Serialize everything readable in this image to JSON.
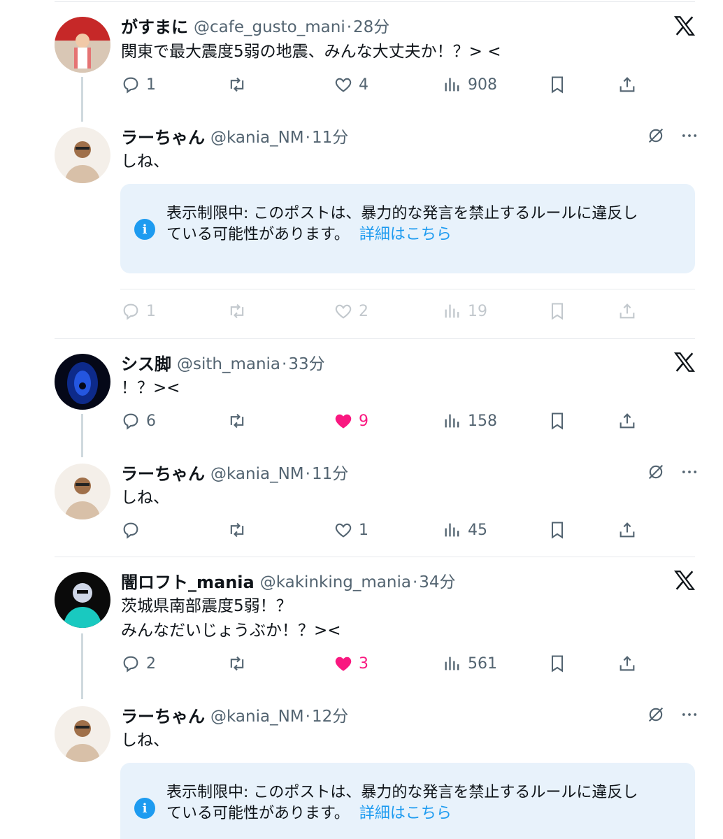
{
  "posts": [
    {
      "name": "がすまに",
      "handle": "@cafe_gusto_mani",
      "time": "28分",
      "body": [
        "関東で最大震度5弱の地震、みんな大丈夫か！？> <"
      ],
      "replies": "1",
      "reposts": "",
      "likes": "4",
      "views": "908",
      "liked": false
    },
    {
      "name": "ラーちゃん",
      "handle": "@kania_NM",
      "time": "11分",
      "body": [
        "しね、"
      ],
      "notice": {
        "line1": "表示制限中: このポストは、暴力的な発言を禁止するルールに違反し",
        "line2": "ている可能性があります。",
        "link": "詳細はこちら"
      },
      "replies": "1",
      "reposts": "",
      "likes": "2",
      "views": "19"
    },
    {
      "name": "シス脚",
      "handle": "@sith_mania",
      "time": "33分",
      "body": [
        "！？><"
      ],
      "replies": "6",
      "reposts": "",
      "likes": "9",
      "views": "158",
      "liked": true
    },
    {
      "name": "ラーちゃん",
      "handle": "@kania_NM",
      "time": "11分",
      "body": [
        "しね、"
      ],
      "replies": "",
      "reposts": "",
      "likes": "1",
      "views": "45"
    },
    {
      "name": "闇ロフト_mania",
      "handle": "@kakinking_mania",
      "time": "34分",
      "body": [
        "茨城県南部震度5弱！？",
        "みんなだいじょうぶか！？><"
      ],
      "replies": "2",
      "reposts": "",
      "likes": "3",
      "views": "561",
      "liked": true
    },
    {
      "name": "ラーちゃん",
      "handle": "@kania_NM",
      "time": "12分",
      "body": [
        "しね、"
      ],
      "notice": {
        "line1": "表示制限中: このポストは、暴力的な発言を禁止するルールに違反し",
        "line2": "ている可能性があります。",
        "link": "詳細はこちら"
      }
    }
  ],
  "icons": {
    "reply": "reply-icon",
    "repost": "repost-icon",
    "like": "heart-icon",
    "views": "views-icon",
    "bookmark": "bookmark-icon",
    "share": "share-icon",
    "x_logo": "x-logo-icon",
    "grok": "grok-icon",
    "more": "more-icon",
    "info": "info-icon"
  },
  "colors": {
    "like": "#f91880",
    "link": "#1d9bf0",
    "notice_bg": "#e8f2fb",
    "muted": "#536471"
  }
}
